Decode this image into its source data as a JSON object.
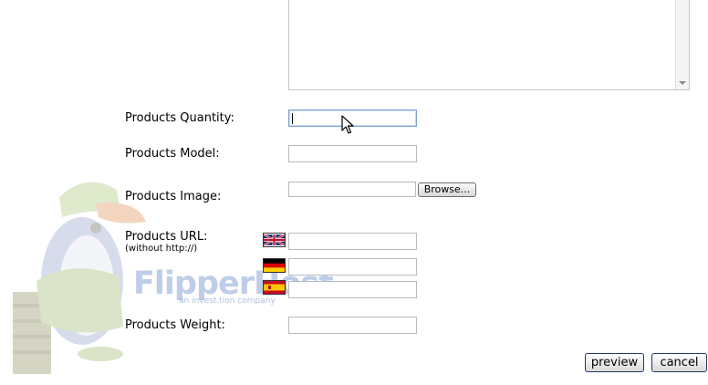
{
  "form": {
    "quantity_label": "Products Quantity:",
    "quantity_value": "",
    "model_label": "Products Model:",
    "model_value": "",
    "image_label": "Products Image:",
    "image_value": "",
    "browse_label": "Browse...",
    "url_label": "Products URL:",
    "url_hint": "(without http://)",
    "url_values": [
      "",
      "",
      ""
    ],
    "weight_label": "Products Weight:",
    "weight_value": ""
  },
  "flags": [
    {
      "icon": "uk-flag-icon",
      "language": "en"
    },
    {
      "icon": "germany-flag-icon",
      "language": "de"
    },
    {
      "icon": "spain-flag-icon",
      "language": "es"
    }
  ],
  "actions": {
    "preview_label": "preview",
    "cancel_label": "cancel"
  },
  "watermark": {
    "brand": "FlipperHost",
    "tagline": "an invest.tion company",
    "cap_text": "FLIPPER HOST"
  }
}
